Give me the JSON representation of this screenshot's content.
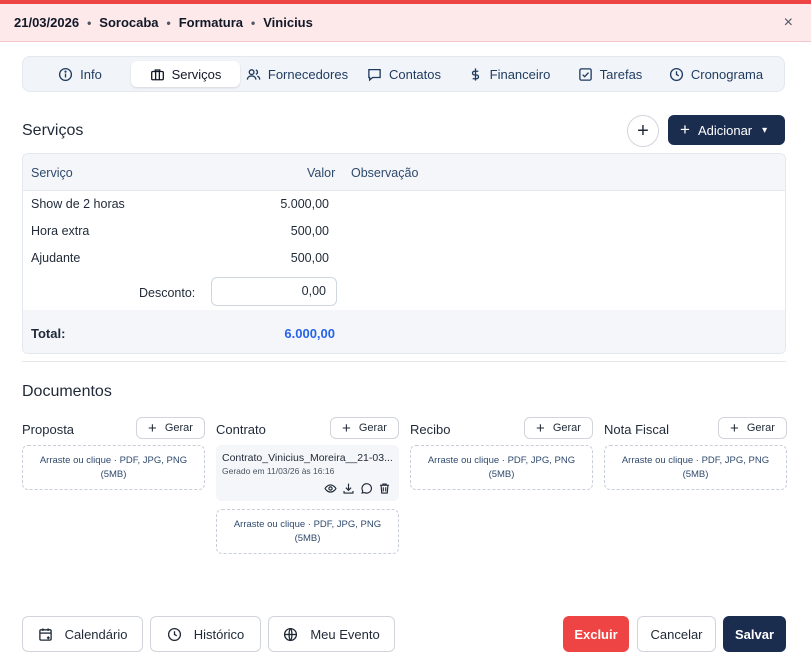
{
  "header": {
    "date": "21/03/2026",
    "city": "Sorocaba",
    "event_type": "Formatura",
    "client": "Vinicius",
    "separator": "•",
    "close_icon": "×"
  },
  "tabs": [
    {
      "label": "Info",
      "icon": "info-icon"
    },
    {
      "label": "Serviços",
      "icon": "briefcase-icon",
      "active": true
    },
    {
      "label": "Fornecedores",
      "icon": "users-icon"
    },
    {
      "label": "Contatos",
      "icon": "message-icon"
    },
    {
      "label": "Financeiro",
      "icon": "dollar-icon"
    },
    {
      "label": "Tarefas",
      "icon": "checkbox-icon"
    },
    {
      "label": "Cronograma",
      "icon": "clock-icon"
    }
  ],
  "services": {
    "title": "Serviços",
    "add_label": "Adicionar",
    "columns": {
      "service": "Serviço",
      "value": "Valor",
      "note": "Observação"
    },
    "rows": [
      {
        "name": "Show de 2 horas",
        "value": "5.000,00",
        "note": ""
      },
      {
        "name": "Hora extra",
        "value": "500,00",
        "note": ""
      },
      {
        "name": "Ajudante",
        "value": "500,00",
        "note": ""
      }
    ],
    "discount_label": "Desconto:",
    "discount_value": "0,00",
    "total_label": "Total:",
    "total_value": "6.000,00"
  },
  "documents": {
    "title": "Documentos",
    "generate_label": "Gerar",
    "drop_text": "Arraste ou clique · PDF, JPG, PNG",
    "drop_size": "(5MB)",
    "columns": [
      {
        "title": "Proposta"
      },
      {
        "title": "Contrato",
        "file": {
          "name": "Contrato_Vinicius_Moreira__21-03...",
          "generated": "Gerado em 11/03/26 às 16:16"
        }
      },
      {
        "title": "Recibo"
      },
      {
        "title": "Nota Fiscal"
      }
    ]
  },
  "footer": {
    "calendar_label": "Calendário",
    "history_label": "Histórico",
    "my_event_label": "Meu Evento",
    "delete_label": "Excluir",
    "cancel_label": "Cancelar",
    "save_label": "Salvar"
  },
  "colors": {
    "accent_red": "#ef4444",
    "navy": "#1b2d4f",
    "total_blue": "#2563eb",
    "header_bg": "#fde8ea"
  }
}
